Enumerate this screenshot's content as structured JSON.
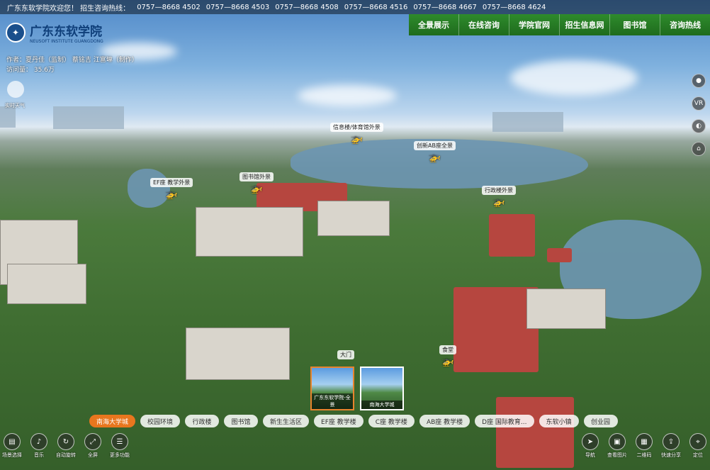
{
  "topbar": {
    "welcome": "广东东软学院欢迎您！ 招生咨询热线：",
    "phones": [
      "0757—8668 4502",
      "0757—8668 4503",
      "0757—8668 4508",
      "0757—8668 4516",
      "0757—8668 4667",
      "0757—8668 4624"
    ]
  },
  "nav": [
    "全景展示",
    "在线咨询",
    "学院官网",
    "招生信息网",
    "图书馆",
    "咨询热线"
  ],
  "logo": {
    "cn": "广东东软学院",
    "en": "NEUSOFT INSTITUTE GUANGDONG"
  },
  "meta": {
    "author": "作者：夏丹佳（监制） 蔡铭吉 江富琳（制作）",
    "visits": "访问量： 35.6万"
  },
  "weather": "实时天气",
  "hotspots": [
    {
      "label": "信息楼/体育馆外景"
    },
    {
      "label": "创新AB座全景"
    },
    {
      "label": "图书馆外景"
    },
    {
      "label": "EF座 教学外景"
    },
    {
      "label": "行政楼外景"
    },
    {
      "label": "大门"
    },
    {
      "label": "食堂"
    }
  ],
  "thumbs": [
    {
      "caption": "广东东软学院-全景",
      "active": true
    },
    {
      "caption": "南海大学城",
      "active": false
    }
  ],
  "scenes": [
    "南海大学城",
    "校园环境",
    "行政楼",
    "图书馆",
    "新生生活区",
    "EF座 教学楼",
    "C座 教学楼",
    "AB座 教学楼",
    "D座 国际教育...",
    "东软小镇",
    "创业园"
  ],
  "tools_left": [
    {
      "icon": "film-icon",
      "label": "场景选择"
    },
    {
      "icon": "music-icon",
      "label": "音乐"
    },
    {
      "icon": "rotate-icon",
      "label": "自动旋转"
    },
    {
      "icon": "fullscreen-icon",
      "label": "全屏"
    },
    {
      "icon": "menu-icon",
      "label": "更多功能"
    }
  ],
  "tools_right": [
    {
      "icon": "send-icon",
      "label": "导航"
    },
    {
      "icon": "image-icon",
      "label": "查看图片"
    },
    {
      "icon": "qrcode-icon",
      "label": "二维码"
    },
    {
      "icon": "share-icon",
      "label": "快速分享"
    },
    {
      "icon": "location-icon",
      "label": "定位"
    }
  ]
}
